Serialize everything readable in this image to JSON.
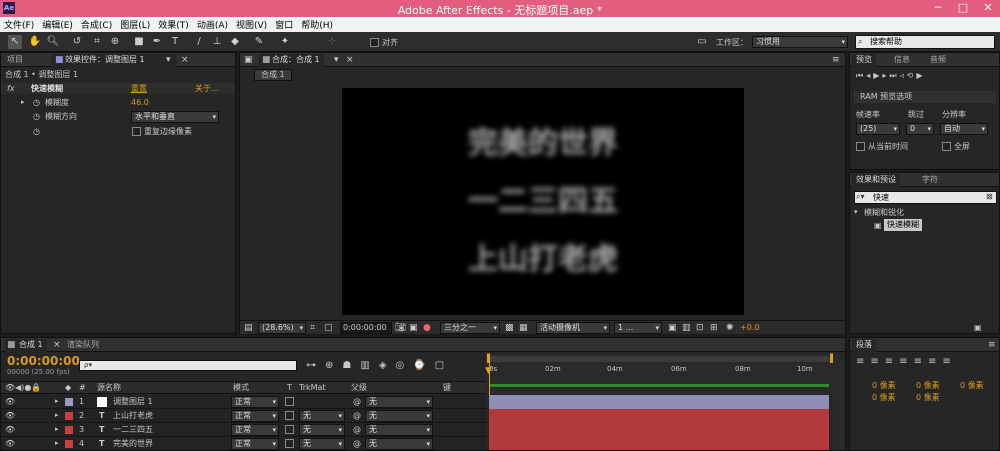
{
  "app": {
    "title": "Adobe After Effects - 无标题项目.aep *",
    "logo": "Ae"
  },
  "window_controls": {
    "minimize": "─",
    "maximize": "□",
    "close": "✕"
  },
  "menu": [
    "文件(F)",
    "编辑(E)",
    "合成(C)",
    "图层(L)",
    "效果(T)",
    "动画(A)",
    "视图(V)",
    "窗口",
    "帮助(H)"
  ],
  "toolbar": {
    "align_label": "对齐",
    "workspace_label": "工作区：",
    "workspace_value": "习惯用",
    "search_placeholder": "搜索帮助"
  },
  "left_panel": {
    "tabs": [
      "项目",
      "效果控件：调整图层 1"
    ],
    "breadcrumb": "合成 1 • 调整图层 1",
    "fx_label": "fx",
    "effect_name": "快速模糊",
    "reset_label": "重置",
    "about_label": "关于...",
    "props": [
      {
        "name": "模糊度",
        "value": "46.0"
      },
      {
        "name": "模糊方向",
        "value": "水平和垂直"
      }
    ],
    "repeat_label": "重复边缘像素"
  },
  "comp_panel": {
    "tab": "合成：合成 1",
    "sub_tab": "合成 1",
    "canvas_lines": [
      "完美的世界",
      "一二三四五",
      "上山打老虎"
    ],
    "zoom": "(28.6%)",
    "timecode": "0:00:00:00",
    "resolution": "三分之一",
    "camera": "活动摄像机",
    "views": "1 ...",
    "exposure": "+0.0"
  },
  "preview_panel": {
    "tabs": [
      "预览",
      "信息",
      "音频"
    ],
    "ram_label": "RAM 预览选项",
    "fps_label": "帧速率",
    "skip_label": "跳过",
    "res_label": "分辨率",
    "fps_value": "(25)",
    "skip_value": "0",
    "res_value": "自动",
    "from_current": "从当前时间",
    "fullscreen": "全屏"
  },
  "effects_panel": {
    "tabs": [
      "效果和预设",
      "字符"
    ],
    "search_value": "快速",
    "category": "模糊和锐化",
    "item": "快速模糊"
  },
  "paragraph_panel": {
    "tab": "段落",
    "px_labels": [
      "0 像素",
      "0 像素",
      "0 像素",
      "0 像素",
      "0 像素"
    ]
  },
  "timeline": {
    "tabs": [
      "合成 1",
      "渲染队列"
    ],
    "timecode": "0:00:00:00",
    "fps": "00000 (25.00 fps)",
    "search_placeholder": "ρ▾",
    "headers": {
      "num": "#",
      "source": "源名称",
      "mode": "模式",
      "t": "T",
      "trkmat": "TrkMat",
      "parent": "父级",
      "keys": "键"
    },
    "ruler": [
      "0s",
      "02m",
      "04m",
      "06m",
      "08m",
      "10m"
    ],
    "layers": [
      {
        "num": "1",
        "name": "调整图层 1",
        "mode": "正常",
        "trk": "",
        "parent": "无",
        "color": "#9a9ac8"
      },
      {
        "num": "2",
        "name": "上山打老虎",
        "mode": "正常",
        "trk": "无",
        "parent": "无",
        "color": "#c84040"
      },
      {
        "num": "3",
        "name": "一二三四五",
        "mode": "正常",
        "trk": "无",
        "parent": "无",
        "color": "#c84040"
      },
      {
        "num": "4",
        "name": "完美的世界",
        "mode": "正常",
        "trk": "无",
        "parent": "无",
        "color": "#c84040"
      }
    ]
  }
}
